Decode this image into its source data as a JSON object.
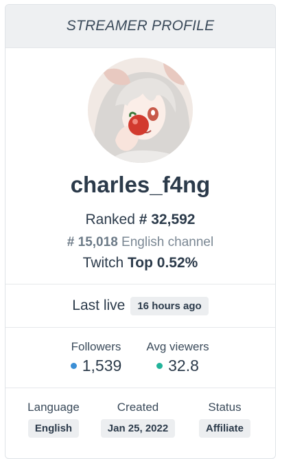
{
  "header": {
    "title": "STREAMER PROFILE"
  },
  "profile": {
    "avatar_icon": "anime-avatar-eating-apple",
    "username": "charles_f4ng",
    "ranked_prefix": "Ranked",
    "ranked_value": "# 32,592",
    "channel_rank": "# 15,018",
    "channel_label": "English channel",
    "twitch_prefix": "Twitch",
    "twitch_top": "Top 0.52%"
  },
  "last_live": {
    "label": "Last live",
    "value": "16 hours ago"
  },
  "stats": {
    "followers_label": "Followers",
    "followers_value": "1,539",
    "followers_color": "#3b8fd6",
    "avg_viewers_label": "Avg viewers",
    "avg_viewers_value": "32.8",
    "avg_viewers_color": "#22b39a"
  },
  "meta": {
    "language_label": "Language",
    "language_value": "English",
    "created_label": "Created",
    "created_value": "Jan 25, 2022",
    "status_label": "Status",
    "status_value": "Affiliate"
  }
}
